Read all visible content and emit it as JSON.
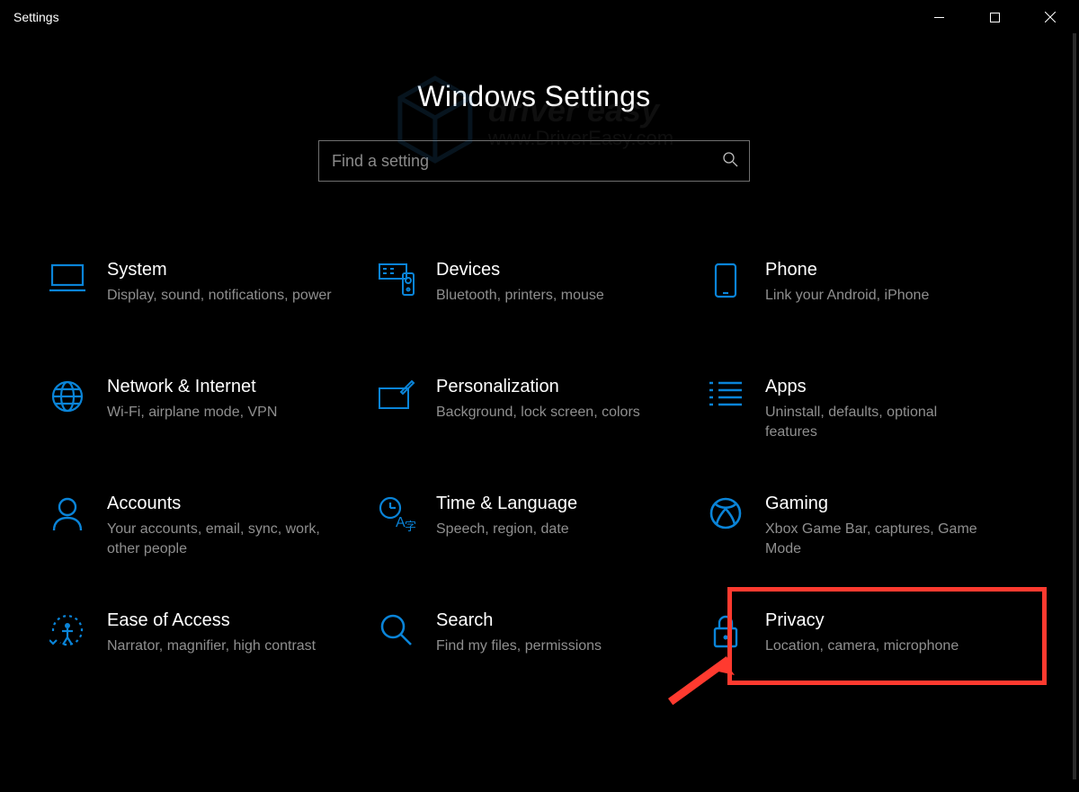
{
  "window": {
    "title": "Settings"
  },
  "header": {
    "title": "Windows Settings"
  },
  "search": {
    "placeholder": "Find a setting"
  },
  "watermark": {
    "line1": "driver easy",
    "line2": "www.DriverEasy.com"
  },
  "tiles": [
    {
      "title": "System",
      "desc": "Display, sound, notifications, power"
    },
    {
      "title": "Devices",
      "desc": "Bluetooth, printers, mouse"
    },
    {
      "title": "Phone",
      "desc": "Link your Android, iPhone"
    },
    {
      "title": "Network & Internet",
      "desc": "Wi-Fi, airplane mode, VPN"
    },
    {
      "title": "Personalization",
      "desc": "Background, lock screen, colors"
    },
    {
      "title": "Apps",
      "desc": "Uninstall, defaults, optional features"
    },
    {
      "title": "Accounts",
      "desc": "Your accounts, email, sync, work, other people"
    },
    {
      "title": "Time & Language",
      "desc": "Speech, region, date"
    },
    {
      "title": "Gaming",
      "desc": "Xbox Game Bar, captures, Game Mode"
    },
    {
      "title": "Ease of Access",
      "desc": "Narrator, magnifier, high contrast"
    },
    {
      "title": "Search",
      "desc": "Find my files, permissions"
    },
    {
      "title": "Privacy",
      "desc": "Location, camera, microphone"
    }
  ],
  "annotation": {
    "highlighted_tile_index": 8
  }
}
